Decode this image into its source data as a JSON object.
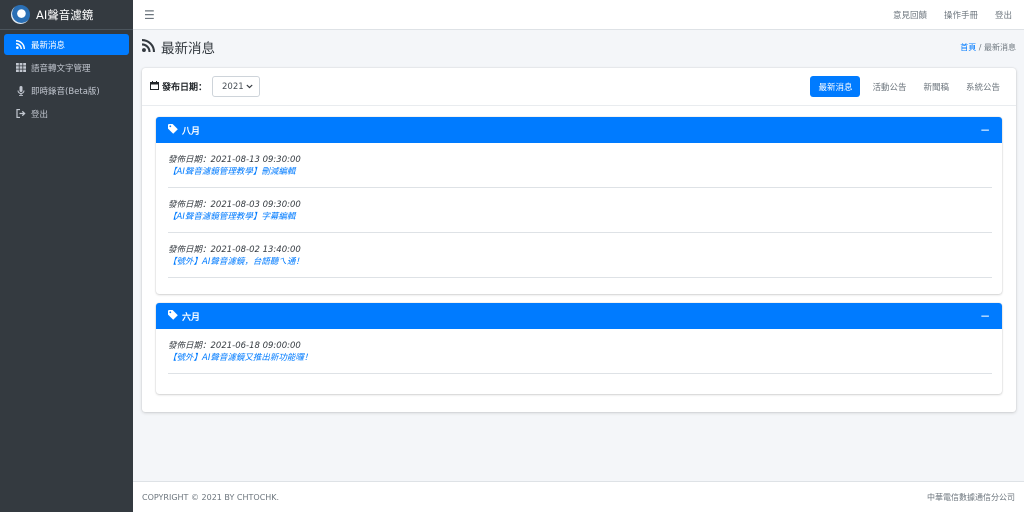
{
  "sidebar": {
    "brand": "AI聲音濾鏡",
    "items": [
      {
        "label": "最新消息",
        "icon": "rss-icon"
      },
      {
        "label": "語音轉文字管理",
        "icon": "grid-icon"
      },
      {
        "label": "即時錄音(Beta版)",
        "icon": "microphone-icon"
      },
      {
        "label": "登出",
        "icon": "sign-out-icon"
      }
    ]
  },
  "topbar": {
    "links": [
      "意見回饋",
      "操作手冊",
      "登出"
    ]
  },
  "header": {
    "title": "最新消息",
    "breadcrumb_home": "首頁",
    "breadcrumb_sep": "/",
    "breadcrumb_current": "最新消息"
  },
  "filter": {
    "date_label": "發布日期：",
    "year": "2021"
  },
  "tabs": [
    "最新消息",
    "活動公告",
    "新聞稿",
    "系統公告"
  ],
  "months": [
    {
      "name": "八月",
      "collapse": "−",
      "items": [
        {
          "date": "發佈日期：2021-08-13 09:30:00",
          "title": "【AI聲音濾鏡管理教學】刪減編輯"
        },
        {
          "date": "發佈日期：2021-08-03 09:30:00",
          "title": "【AI聲音濾鏡管理教學】字幕編輯"
        },
        {
          "date": "發佈日期：2021-08-02 13:40:00",
          "title": "【號外】AI聲音濾鏡，台語聽ㄟ通！"
        }
      ]
    },
    {
      "name": "六月",
      "collapse": "−",
      "items": [
        {
          "date": "發佈日期：2021-06-18 09:00:00",
          "title": "【號外】AI聲音濾鏡又推出新功能囉！"
        }
      ]
    }
  ],
  "footer": {
    "copyright": "COPYRIGHT © 2021 BY CHTOCHK.",
    "company": "中華電信數據通信分公司"
  },
  "colors": {
    "primary": "#007bff",
    "sidebar": "#343a40"
  }
}
